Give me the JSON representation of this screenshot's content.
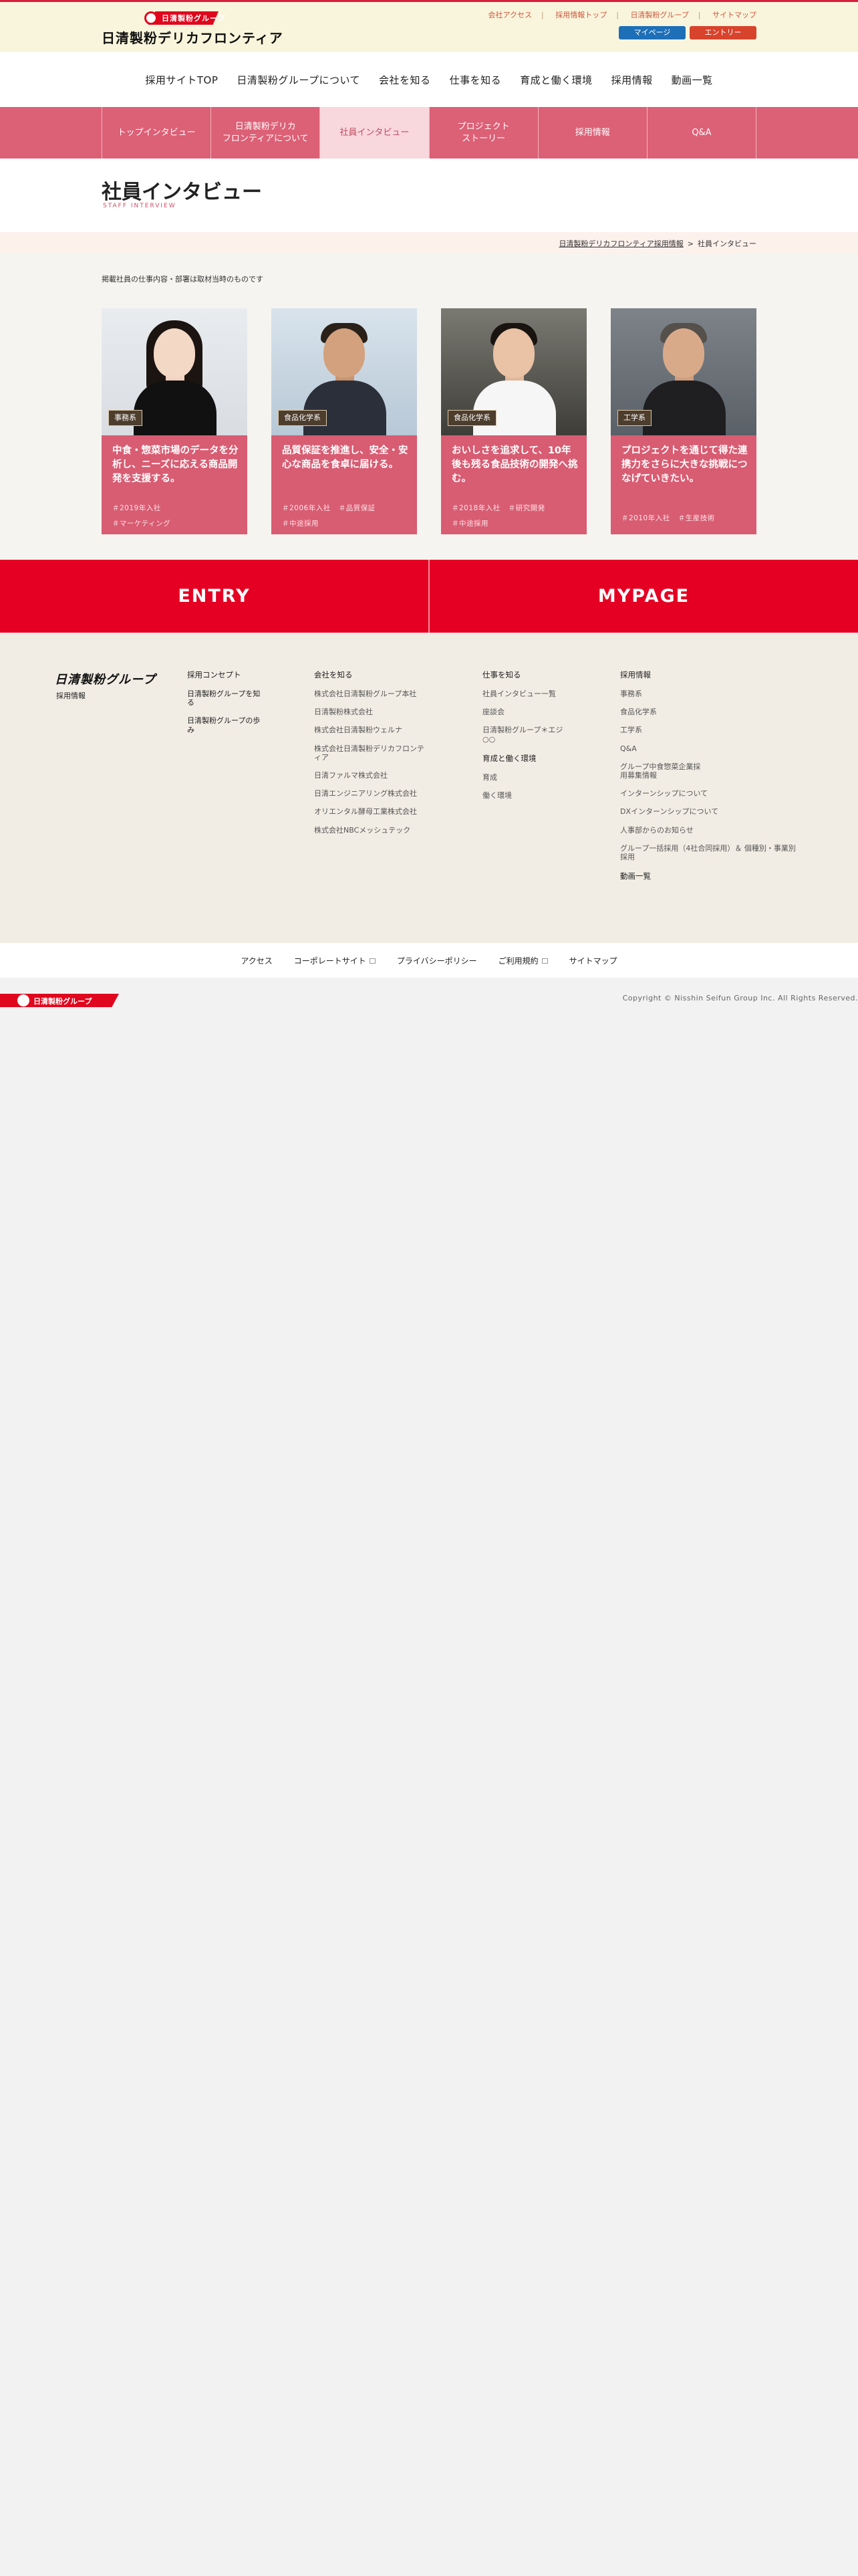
{
  "header": {
    "logo_group": "日清製粉グループ",
    "logo_name": "日清製粉デリカフロンティア",
    "utility_links": [
      "会社アクセス",
      "採用情報トップ",
      "日清製粉グループ",
      "サイトマップ"
    ],
    "mypage_label": "マイページ",
    "entry_label": "エントリー"
  },
  "main_nav": [
    "採用サイトTOP",
    "日清製粉グループについて",
    "会社を知る",
    "仕事を知る",
    "育成と働く環境",
    "採用情報",
    "動画一覧"
  ],
  "sub_nav": [
    "トップインタビュー",
    "日清製粉デリカ\nフロンティアについて",
    "社員インタビュー",
    "プロジェクト\nストーリー",
    "採用情報",
    "Q&A"
  ],
  "page": {
    "title": "社員インタビュー",
    "title_en": "STAFF INTERVIEW"
  },
  "breadcrumb": {
    "parent": "日清製粉デリカフロンティア採用情報",
    "current": "社員インタビュー"
  },
  "note": "掲載社員の仕事内容・部署は取材当時のものです",
  "cards": [
    {
      "category": "事務系",
      "headline": "中食・惣菜市場のデータを分析し、ニーズに応える商品開発を支援する。",
      "tags": [
        "＃2019年入社",
        "＃マーケティング"
      ]
    },
    {
      "category": "食品化学系",
      "headline": "品質保証を推進し、安全・安心な商品を食卓に届ける。",
      "tags": [
        "＃2006年入社",
        "＃品質保証",
        "＃中途採用"
      ]
    },
    {
      "category": "食品化学系",
      "headline": "おいしさを追求して、10年後も残る食品技術の開発へ挑む。",
      "tags": [
        "＃2018年入社",
        "＃研究開発",
        "＃中途採用"
      ]
    },
    {
      "category": "工学系",
      "headline": "プロジェクトを通じて得た連携力をさらに大きな挑戦につなげていきたい。",
      "tags": [
        "＃2010年入社",
        "＃生産技術"
      ]
    }
  ],
  "cta": {
    "entry": "ENTRY",
    "mypage": "MYPAGE"
  },
  "footer": {
    "logo": "日清製粉グループ",
    "sub": "採用情報",
    "col1": [
      "採用コンセプト",
      "日清製粉グループを知る",
      "日清製粉グループの歩み"
    ],
    "col2_heading": "会社を知る",
    "col2": [
      "株式会社日清製粉グループ本社",
      "日清製粉株式会社",
      "株式会社日清製粉ウェルナ",
      "株式会社日清製粉デリカフロンティア",
      "日清ファルマ株式会社",
      "日清エンジニアリング株式会社",
      "オリエンタル酵母工業株式会社",
      "株式会社NBCメッシュテック"
    ],
    "col3_heading": "仕事を知る",
    "col3": [
      "社員インタビュー一覧",
      "座談会",
      "日清製粉グループ＊エジ○○"
    ],
    "col3_heading2": "育成と働く環境",
    "col3b": [
      "育成",
      "働く環境"
    ],
    "col4_heading": "採用情報",
    "col4": [
      "事務系",
      "食品化学系",
      "工学系",
      "Q&A",
      "グループ中食惣菜企業採用募集情報",
      "インターンシップについて",
      "DXインターンシップについて",
      "人事部からのお知らせ",
      "グループ一括採用（4社合同採用）＆ 個種別・事業別採用"
    ],
    "col4_last": "動画一覧"
  },
  "bottom_links": [
    "アクセス",
    "コーポレートサイト",
    "プライバシーポリシー",
    "ご利用規約",
    "サイトマップ"
  ],
  "copyright": {
    "logo": "日清製粉グループ",
    "text": "Copyright © Nisshin Seifun Group Inc. All Rights Reserved."
  }
}
